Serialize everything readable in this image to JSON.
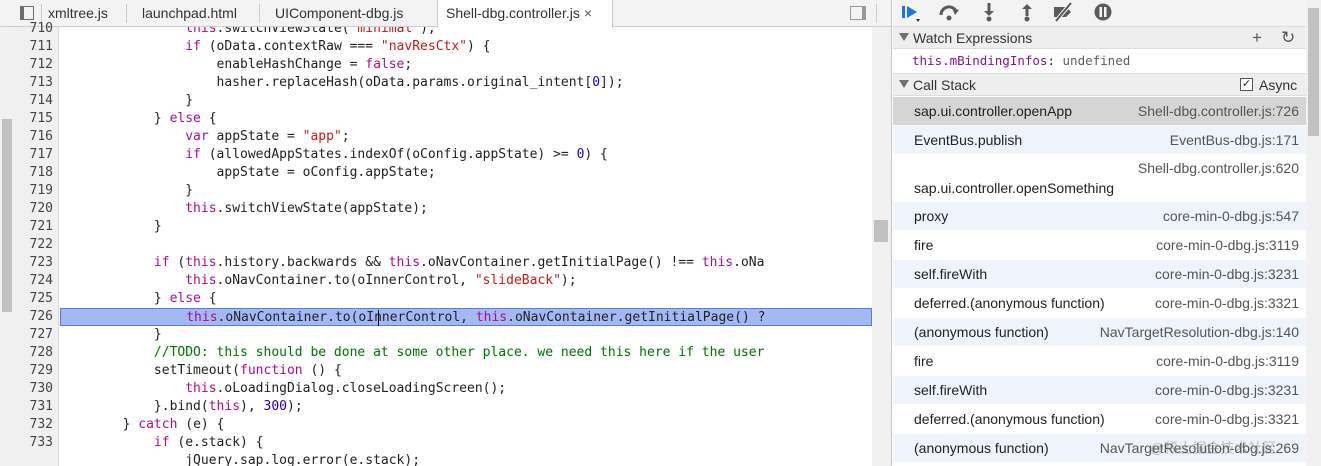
{
  "tabs": [
    {
      "label": "xmltree.js",
      "active": false
    },
    {
      "label": "launchpad.html",
      "active": false
    },
    {
      "label": "UIComponent-dbg.js",
      "active": false
    },
    {
      "label": "Shell-dbg.controller.js",
      "active": true
    }
  ],
  "tab_close_glyph": "×",
  "editor": {
    "line_numbers": [
      "710",
      "711",
      "712",
      "713",
      "714",
      "715",
      "716",
      "717",
      "718",
      "719",
      "720",
      "721",
      "722",
      "723",
      "724",
      "725",
      "726",
      "727",
      "728",
      "729",
      "730",
      "731",
      "732",
      "733"
    ],
    "highlighted_line": "726"
  },
  "debugger_toolbar": {
    "buttons": [
      "resume-icon",
      "step-over-icon",
      "step-into-icon",
      "step-out-icon",
      "deactivate-breakpoints-icon",
      "pause-on-exceptions-icon"
    ]
  },
  "watch": {
    "title": "Watch Expressions",
    "add_glyph": "+",
    "refresh_glyph": "↻",
    "items": [
      {
        "name": "this.mBindingInfos",
        "sep": ": ",
        "value": "undefined"
      }
    ]
  },
  "call_stack": {
    "title": "Call Stack",
    "async_label": "Async",
    "async_checked": true,
    "async_check_glyph": "✓",
    "frames": [
      {
        "fn": "sap.ui.controller.openApp",
        "loc": "Shell-dbg.controller.js:726"
      },
      {
        "fn": "EventBus.publish",
        "loc": "EventBus-dbg.js:171"
      },
      {
        "fn": "sap.ui.controller.openSomething",
        "loc": "Shell-dbg.controller.js:620"
      },
      {
        "fn": "proxy",
        "loc": "core-min-0-dbg.js:547"
      },
      {
        "fn": "fire",
        "loc": "core-min-0-dbg.js:3119"
      },
      {
        "fn": "self.fireWith",
        "loc": "core-min-0-dbg.js:3231"
      },
      {
        "fn": "deferred.(anonymous function)",
        "loc": "core-min-0-dbg.js:3321"
      },
      {
        "fn": "(anonymous function)",
        "loc": "NavTargetResolution-dbg.js:140"
      },
      {
        "fn": "fire",
        "loc": "core-min-0-dbg.js:3119"
      },
      {
        "fn": "self.fireWith",
        "loc": "core-min-0-dbg.js:3231"
      },
      {
        "fn": "deferred.(anonymous function)",
        "loc": "core-min-0-dbg.js:3321"
      },
      {
        "fn": "(anonymous function)",
        "loc": "NavTargetResolution-dbg.js:269"
      }
    ]
  },
  "watermark": "@稀土掘金技术社区"
}
